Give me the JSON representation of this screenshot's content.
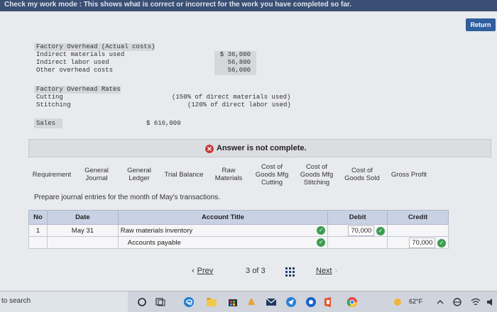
{
  "topbar": {
    "title": "Check my work mode : This shows what is correct or incorrect for the work you have completed so far."
  },
  "return_label": "Return",
  "overhead_actual": {
    "heading": "Factory Overhead (Actual costs)",
    "rows": [
      {
        "label": "Indirect materials used",
        "value": "$ 36,000"
      },
      {
        "label": "Indirect labor used",
        "value": "56,800"
      },
      {
        "label": "Other overhead costs",
        "value": "56,000"
      }
    ]
  },
  "overhead_rates": {
    "heading": "Factory Overhead Rates",
    "rows": [
      {
        "label": "Cutting",
        "note": "(150% of direct materials used)"
      },
      {
        "label": "Stitching",
        "note": "(120% of direct labor used)"
      }
    ]
  },
  "sales": {
    "label": "Sales",
    "value": "$ 616,000"
  },
  "answer_status": "Answer is not complete.",
  "tabs": [
    {
      "label": "Requirement"
    },
    {
      "label": "General Journal"
    },
    {
      "label": "General Ledger"
    },
    {
      "label": "Trial Balance"
    },
    {
      "label": "Raw Materials"
    },
    {
      "label": "Cost of Goods Mfg Cutting"
    },
    {
      "label": "Cost of Goods Mfg Stitching"
    },
    {
      "label": "Cost of Goods Sold"
    },
    {
      "label": "Gross Profit"
    }
  ],
  "instruction": "Prepare journal entries for the month of May's transactions.",
  "journal": {
    "headers": {
      "no": "No",
      "date": "Date",
      "account": "Account Title",
      "debit": "Debit",
      "credit": "Credit"
    },
    "rows": [
      {
        "no": "1",
        "date": "May 31",
        "account": "Raw materials inventory",
        "debit": "70,000",
        "credit": ""
      },
      {
        "no": "",
        "date": "",
        "account": "Accounts payable",
        "debit": "",
        "credit": "70,000"
      }
    ]
  },
  "pager": {
    "prev": "Prev",
    "page": "3",
    "of": "of",
    "total": "3",
    "next": "Next"
  },
  "taskbar": {
    "search": "to search",
    "temperature": "62°F"
  }
}
